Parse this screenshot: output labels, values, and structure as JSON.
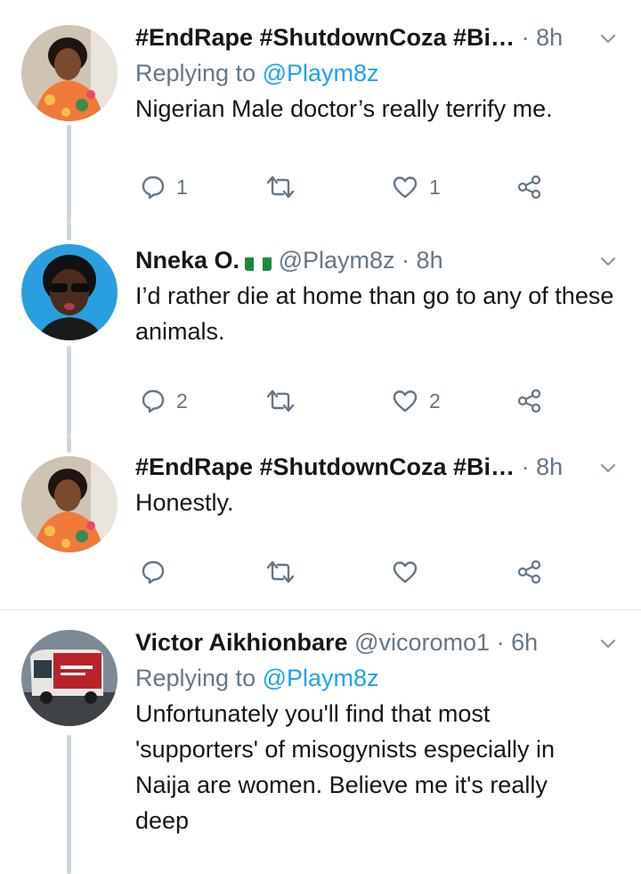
{
  "tweets": [
    {
      "name": "#EndRape #ShutdownCoza #Bi…",
      "handle": "",
      "dot": "·",
      "time": "8h",
      "replying_prefix": "Replying to",
      "replying_handle": "@Playm8z",
      "text": "Nigerian Male doctor’s really terrify me.",
      "replies": "1",
      "retweets": "",
      "likes": "1"
    },
    {
      "name": "Nneka O.",
      "flag": "nigeria-flag",
      "handle": "@Playm8z",
      "dot": "·",
      "time": "8h",
      "text": "I’d rather die at home than go to any of these animals.",
      "replies": "2",
      "retweets": "",
      "likes": "2"
    },
    {
      "name": "#EndRape #ShutdownCoza #Bi…",
      "handle": "",
      "dot": "·",
      "time": "8h",
      "text": "Honestly.",
      "replies": "",
      "retweets": "",
      "likes": ""
    },
    {
      "name": "Victor Aikhionbare",
      "handle": "@vicoromo1",
      "dot": "·",
      "time": "6h",
      "replying_prefix": "Replying to",
      "replying_handle": "@Playm8z",
      "text": "Unfortunately you'll find that most 'supporters' of misogynists especially in Naija are women. Believe me it's really deep"
    }
  ],
  "colors": {
    "link": "#1da1f2",
    "muted": "#657786",
    "thread_line": "#ccd6dd"
  }
}
